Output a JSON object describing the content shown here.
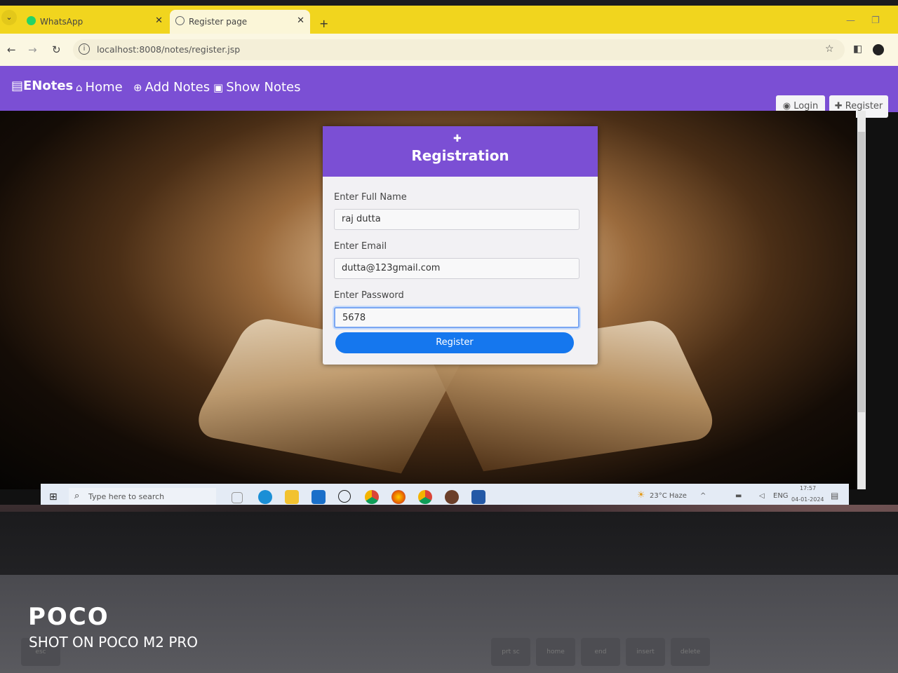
{
  "browser": {
    "tabs": [
      {
        "label": "WhatsApp",
        "active": false,
        "favicon_color": "#25d366"
      },
      {
        "label": "Register page",
        "active": true,
        "favicon_color": "#5f6368"
      }
    ],
    "url": "localhost:8008/notes/register.jsp",
    "icons": [
      "back-icon",
      "forward-icon",
      "reload-icon",
      "site-info-icon",
      "star-icon",
      "side-panel-icon",
      "profile-icon",
      "minimize-icon",
      "restore-icon",
      "close-tab-icon",
      "new-tab-icon"
    ]
  },
  "navbar": {
    "brand": "ENotes",
    "links": [
      "Home",
      "Add Notes",
      "Show Notes"
    ],
    "login": "Login",
    "register": "Register",
    "color": "#7b4fd4"
  },
  "form": {
    "title": "Registration",
    "name_label": "Enter Full Name",
    "name_value": "raj dutta",
    "email_label": "Enter Email",
    "email_value": "dutta@123gmail.com",
    "password_label": "Enter Password",
    "password_value": "5678",
    "submit": "Register",
    "button_color": "#1577ee"
  },
  "taskbar": {
    "search_placeholder": "Type here to search",
    "weather": "23°C Haze",
    "lang": "ENG",
    "time": "17:57",
    "date": "04-01-2024"
  },
  "keyboard": [
    "esc",
    "prt sc",
    "home",
    "end",
    "insert",
    "delete"
  ],
  "watermark": {
    "brand": "POCO",
    "subtitle": "SHOT ON POCO M2 PRO"
  }
}
